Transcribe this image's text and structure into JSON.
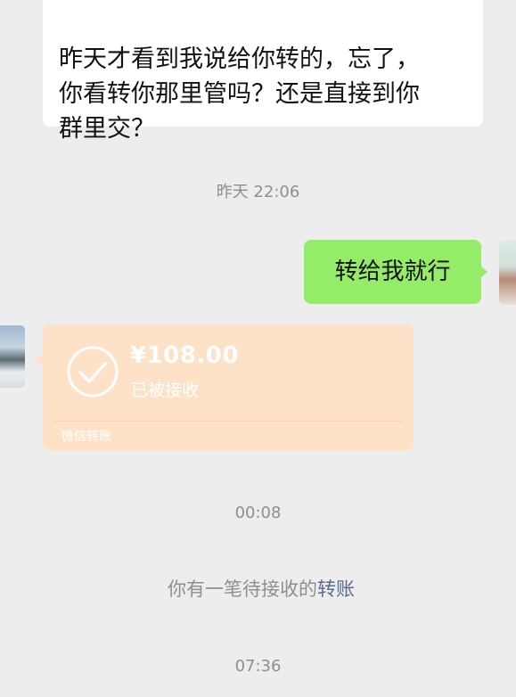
{
  "messages": {
    "incoming_text": "昨天才看到我说给你转的，忘了，\n你看转你那里管吗？还是直接到你\n群里交？",
    "timestamp_1": "昨天 22:06",
    "outgoing_text": "转给我就行",
    "transfer": {
      "amount": "¥108.00",
      "status": "已被接收",
      "brand": "微信转账"
    },
    "timestamp_2": "00:08",
    "system_notice_prefix": "你有一笔待接收的",
    "system_notice_link": "转账",
    "timestamp_3": "07:36"
  },
  "colors": {
    "chat_background": "#ededed",
    "incoming_bubble": "#ffffff",
    "outgoing_bubble": "#95ec69",
    "transfer_card": "#fde2c8",
    "link": "#576b95"
  },
  "icons": {
    "transfer_status": "check-circle-icon"
  }
}
